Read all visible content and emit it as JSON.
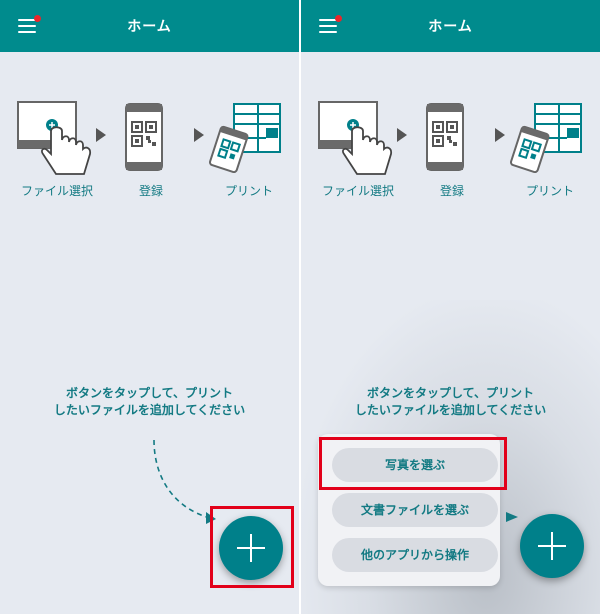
{
  "header": {
    "title": "ホーム"
  },
  "steps": [
    {
      "label": "ファイル選択"
    },
    {
      "label": "登録"
    },
    {
      "label": "プリント"
    }
  ],
  "instruction": {
    "line1": "ボタンをタップして、プリント",
    "line2": "したいファイルを追加してください"
  },
  "add_menu": {
    "items": [
      {
        "label": "写真を選ぶ"
      },
      {
        "label": "文書ファイルを選ぶ"
      },
      {
        "label": "他のアプリから操作"
      }
    ]
  },
  "icons": {
    "menu": "hamburger-icon",
    "notification": "red-dot-badge",
    "add": "plus-icon"
  },
  "colors": {
    "header": "#008b8d",
    "accent_text": "#137a83",
    "fab": "#00808a",
    "background": "#e6eaf1",
    "highlight": "#e2001a",
    "badge": "#e8262b"
  }
}
